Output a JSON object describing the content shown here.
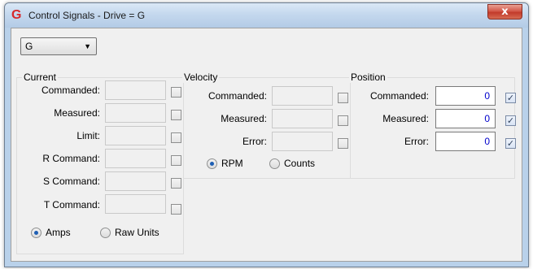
{
  "window": {
    "icon": "G",
    "title": "Control Signals - Drive = G",
    "close_glyph": "x",
    "accent_color": "#d8282b"
  },
  "drive_select": {
    "value": "G"
  },
  "current": {
    "title": "Current",
    "commanded_label": "Commanded:",
    "measured_label": "Measured:",
    "limit_label": "Limit:",
    "r_command_label": "R Command:",
    "s_command_label": "S Command:",
    "t_command_label": "T Command:",
    "units": {
      "option1": "Amps",
      "option2": "Raw Units",
      "selected": "Amps"
    }
  },
  "velocity": {
    "title": "Velocity",
    "commanded_label": "Commanded:",
    "measured_label": "Measured:",
    "error_label": "Error:",
    "units": {
      "option1": "RPM",
      "option2": "Counts",
      "selected": "RPM"
    }
  },
  "position": {
    "title": "Position",
    "commanded_label": "Commanded:",
    "commanded_value": "0",
    "measured_label": "Measured:",
    "measured_value": "0",
    "error_label": "Error:",
    "error_value": "0",
    "check_glyph": "✓"
  }
}
